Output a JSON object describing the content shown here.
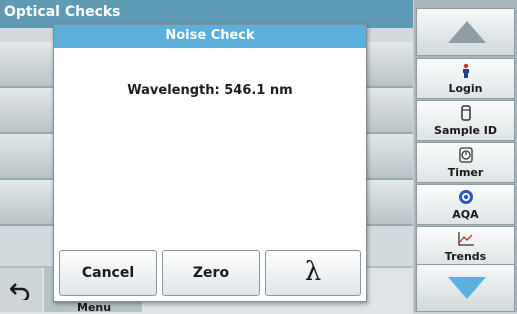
{
  "app": {
    "title": "Optical Checks",
    "menu_label": "Menu"
  },
  "dialog": {
    "title": "Noise Check",
    "wavelength_text": "Wavelength: 546.1 nm",
    "buttons": {
      "cancel": "Cancel",
      "zero": "Zero",
      "lambda": "λ"
    }
  },
  "sidebar": {
    "items": [
      {
        "label": "Login",
        "icon": "person-icon"
      },
      {
        "label": "Sample ID",
        "icon": "sample-vial-icon"
      },
      {
        "label": "Timer",
        "icon": "timer-icon"
      },
      {
        "label": "AQA",
        "icon": "aqa-globe-icon"
      },
      {
        "label": "Trends",
        "icon": "trends-chart-icon"
      }
    ]
  },
  "colors": {
    "accent": "#5aaed9",
    "title_bar": "#5f9bb5",
    "arrow": "#5ab0de"
  }
}
